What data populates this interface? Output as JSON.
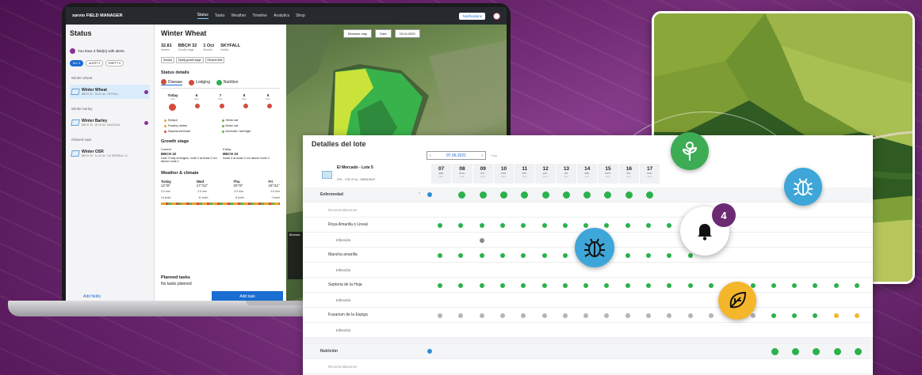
{
  "laptop": {
    "brand": "xarvio FIELD MANAGER",
    "nav": [
      {
        "label": "Status",
        "active": true
      },
      {
        "label": "Tasks",
        "active": false
      },
      {
        "label": "Weather",
        "active": false
      },
      {
        "label": "Timeline",
        "active": false
      },
      {
        "label": "Analytics",
        "active": false
      },
      {
        "label": "Shop",
        "active": false
      }
    ],
    "notifications_label": "Notifications",
    "status_title": "Status",
    "alert_text": "You have 3 field(s) with alerts",
    "chips": [
      "ALL 9",
      "ALERT 3",
      "EMPTY 0"
    ],
    "groups": [
      {
        "name": "Winter wheat",
        "fields": [
          {
            "name": "Winter Wheat",
            "sub": "BBCH 32 · 32.81 ha · SKYFALL",
            "selected": true,
            "alert": true
          }
        ]
      },
      {
        "name": "Winter barley",
        "fields": [
          {
            "name": "Winter Barley",
            "sub": "BBCH 30 · 25.78 ha · BAZOOKA",
            "selected": false,
            "alert": true
          }
        ]
      },
      {
        "name": "Oilseed rape",
        "fields": [
          {
            "name": "Winter OSR",
            "sub": "BBCH 30 · 14.10 ha · DK IMPERIAL CL",
            "selected": false,
            "alert": false
          }
        ]
      }
    ],
    "add_fields": "Add fields",
    "detail": {
      "title": "Winter Wheat",
      "stats": [
        {
          "value": "32.81",
          "label": "hectare"
        },
        {
          "value": "BBCH 32",
          "label": "Growth stage"
        },
        {
          "value": "1 Oct",
          "label": "Seeded"
        },
        {
          "value": "SKYFALL",
          "label": "Variety"
        }
      ],
      "buttons": [
        "Seeded",
        "Modify growth stage",
        "Rename field"
      ],
      "status_details": "Status details",
      "tabs": [
        "Disease",
        "Lodging",
        "Nutrition"
      ],
      "days": [
        {
          "n": "Today",
          "m": "May"
        },
        {
          "n": "6",
          "m": "May"
        },
        {
          "n": "7",
          "m": "May"
        },
        {
          "n": "8",
          "m": "May"
        },
        {
          "n": "9",
          "m": "May"
        }
      ],
      "legend": [
        "Eyespot",
        "Yellow rust",
        "Powdery mildew",
        "Brown rust",
        "Septoria leaf blotch",
        "Net blotch / leaf blight"
      ],
      "growth_stage": "Growth stage",
      "gs_current_label": "Current",
      "gs_current": "BBCH 32",
      "gs_next_label": "9 May",
      "gs_next": "BBCH 33",
      "gs_current_desc": "Leaf 3 fully emerged; node 2 at least 2 cm above node 1",
      "gs_next_desc": "Node 3 at least 2 cm above node 2",
      "weather_title": "Weather & climate",
      "weather_days": [
        {
          "d": "Today",
          "t": "12°/8°"
        },
        {
          "d": "Wed",
          "t": "17°/12°"
        },
        {
          "d": "Thu",
          "t": "20°/9°"
        },
        {
          "d": "Fri",
          "t": "18°/11°"
        }
      ],
      "rain": [
        "2.0 mm",
        "2.0 mm",
        "3.0 mm",
        "0.0 mm"
      ],
      "wind": [
        "14 km/h",
        "11 km/h",
        "8 km/h",
        "7 km/h"
      ],
      "planned_title": "Planned tasks",
      "planned_text": "No tasks planned",
      "add_task": "Add task"
    },
    "map": {
      "layer": "Biomass map",
      "date_label": "Date",
      "date": "15.04.2020",
      "legend_title": "Biomass"
    }
  },
  "table": {
    "title": "Detalles del lote",
    "date": "07.06.2021",
    "today": "Hoy",
    "lote_name": "El Mercado - Lote 5",
    "lote_sub": "291 - 230.3 ha - ÁMBUBAY",
    "days": [
      {
        "n": "07",
        "w": "sáb.",
        "s": "sept."
      },
      {
        "n": "08",
        "w": "dom.",
        "s": "sept."
      },
      {
        "n": "09",
        "w": "lun.",
        "s": "sept."
      },
      {
        "n": "10",
        "w": "mar.",
        "s": "sept."
      },
      {
        "n": "11",
        "w": "mié.",
        "s": "sept."
      },
      {
        "n": "12",
        "w": "jue.",
        "s": "sept."
      },
      {
        "n": "13",
        "w": "vie.",
        "s": "sept."
      },
      {
        "n": "14",
        "w": "sáb.",
        "s": "sept."
      },
      {
        "n": "15",
        "w": "dom.",
        "s": "sept."
      },
      {
        "n": "16",
        "w": "lun.",
        "s": "sept."
      },
      {
        "n": "17",
        "w": "mar.",
        "s": "sept."
      }
    ],
    "rows": [
      {
        "label": "Enfermedad",
        "kind": "head"
      },
      {
        "label": "Recomendaciones",
        "kind": "mute"
      },
      {
        "label": "Roya Amarilla o Lineal",
        "kind": "item"
      },
      {
        "label": "Infección",
        "kind": "sub"
      },
      {
        "label": "Mancha amarilla",
        "kind": "item"
      },
      {
        "label": "Infección",
        "kind": "sub"
      },
      {
        "label": "Septoria de la Hoja",
        "kind": "item"
      },
      {
        "label": "Infección",
        "kind": "sub"
      },
      {
        "label": "Fusarium de la Espiga",
        "kind": "item"
      },
      {
        "label": "Infección",
        "kind": "sub"
      }
    ],
    "rows2": [
      {
        "label": "Nutrición",
        "kind": "head"
      },
      {
        "label": "Recomendaciones",
        "kind": "mute"
      }
    ],
    "notification_count": "4"
  },
  "colors": {
    "brand_purple": "#6b2a72",
    "green": "#2bb24c",
    "yellow": "#f4b62a",
    "grey": "#b5b5b5",
    "blue": "#3ea6d8"
  }
}
